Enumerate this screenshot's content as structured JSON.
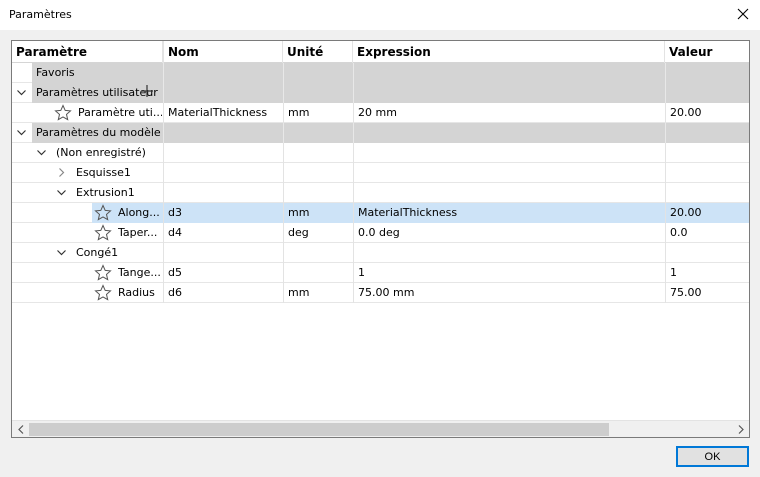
{
  "window": {
    "title": "Paramètres",
    "close_glyph": "✕"
  },
  "table": {
    "columns": [
      "Paramètre",
      "Nom",
      "Unité",
      "Expression",
      "Valeur"
    ],
    "rows": [
      {
        "label": "Favoris",
        "nom": "",
        "unite": "",
        "expr": "",
        "val": ""
      },
      {
        "label": "Paramètres utilisateur",
        "nom": "",
        "unite": "",
        "expr": "",
        "val": ""
      },
      {
        "label": "Paramètre uti...",
        "nom": "MaterialThickness",
        "unite": "mm",
        "expr": "20 mm",
        "val": "20.00"
      },
      {
        "label": "Paramètres du modèle",
        "nom": "",
        "unite": "",
        "expr": "",
        "val": ""
      },
      {
        "label": "(Non enregistré)",
        "nom": "",
        "unite": "",
        "expr": "",
        "val": ""
      },
      {
        "label": "Esquisse1",
        "nom": "",
        "unite": "",
        "expr": "",
        "val": ""
      },
      {
        "label": "Extrusion1",
        "nom": "",
        "unite": "",
        "expr": "",
        "val": ""
      },
      {
        "label": "Along...",
        "nom": "d3",
        "unite": "mm",
        "expr": "MaterialThickness",
        "val": "20.00"
      },
      {
        "label": "Taper...",
        "nom": "d4",
        "unite": "deg",
        "expr": "0.0 deg",
        "val": "0.0"
      },
      {
        "label": "Congé1",
        "nom": "",
        "unite": "",
        "expr": "",
        "val": ""
      },
      {
        "label": "Tange...",
        "nom": "d5",
        "unite": "",
        "expr": "1",
        "val": "1"
      },
      {
        "label": "Radius",
        "nom": "d6",
        "unite": "mm",
        "expr": "75.00 mm",
        "val": "75.00"
      }
    ]
  },
  "buttons": {
    "ok": "OK"
  },
  "icons": {
    "expand": "chevron-down-icon",
    "collapsed": "chevron-right-icon",
    "favorite": "star-outline-icon",
    "add": "plus-icon",
    "close": "close-icon",
    "scroll_left": "scroll-left-icon",
    "scroll_right": "scroll-right-icon"
  },
  "colors": {
    "selection": "#cde3f7",
    "group_background": "#d4d4d4",
    "ok_border": "#0078d7"
  }
}
